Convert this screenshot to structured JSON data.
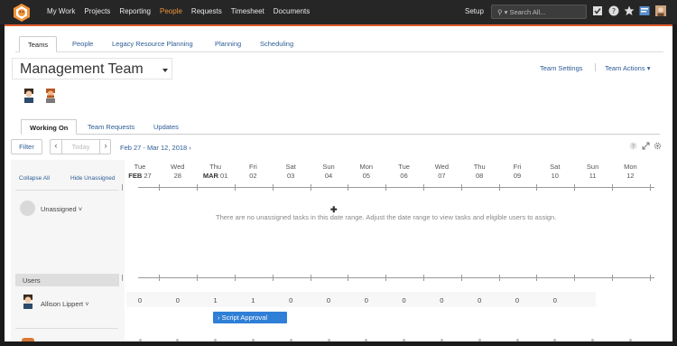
{
  "topnav": {
    "items": [
      "My Work",
      "Projects",
      "Reporting",
      "People",
      "Requests",
      "Timesheet",
      "Documents"
    ],
    "active": "People",
    "setup": "Setup",
    "search_placeholder": "Search All...",
    "accent": "#e05a2b",
    "active_color": "#f0943a"
  },
  "subtabs": [
    "Teams",
    "People",
    "Legacy Resource Planning",
    "Planning",
    "Scheduling"
  ],
  "team": {
    "title": "Management Team",
    "settings": "Team Settings",
    "actions": "Team Actions ▾"
  },
  "work_tabs": [
    "Working On",
    "Team Requests",
    "Updates"
  ],
  "toolbar": {
    "filter": "Filter",
    "prev": "‹",
    "today": "Today",
    "next": "›",
    "range": "Feb 27 - Mar 12, 2018 ›"
  },
  "left_panel": {
    "collapse_all": "Collapse All",
    "hide_unassigned": "Hide Unassigned",
    "unassigned": "Unassigned ˅",
    "users_header": "Users",
    "user_name": "Allison Lippert ˅"
  },
  "days": [
    {
      "dow": "Tue",
      "month": "FEB",
      "date": "27"
    },
    {
      "dow": "Wed",
      "month": "",
      "date": "28"
    },
    {
      "dow": "Thu",
      "month": "MAR",
      "date": "01"
    },
    {
      "dow": "Fri",
      "month": "",
      "date": "02"
    },
    {
      "dow": "Sat",
      "month": "",
      "date": "03"
    },
    {
      "dow": "Sun",
      "month": "",
      "date": "04"
    },
    {
      "dow": "Mon",
      "month": "",
      "date": "05"
    },
    {
      "dow": "Tue",
      "month": "",
      "date": "06"
    },
    {
      "dow": "Wed",
      "month": "",
      "date": "07"
    },
    {
      "dow": "Thu",
      "month": "",
      "date": "08"
    },
    {
      "dow": "Fri",
      "month": "",
      "date": "09"
    },
    {
      "dow": "Sat",
      "month": "",
      "date": "10"
    },
    {
      "dow": "Sun",
      "month": "",
      "date": "11"
    },
    {
      "dow": "Mon",
      "month": "",
      "date": "12"
    }
  ],
  "empty_message": "There are no unassigned tasks in this date range. Adjust the date range to view tasks and eligible users to assign.",
  "user_counts": [
    "0",
    "0",
    "1",
    "1",
    "0",
    "0",
    "0",
    "0",
    "0",
    "0",
    "0",
    "0"
  ],
  "task": {
    "label": "› Script Approval",
    "color": "#2f7fd6"
  }
}
